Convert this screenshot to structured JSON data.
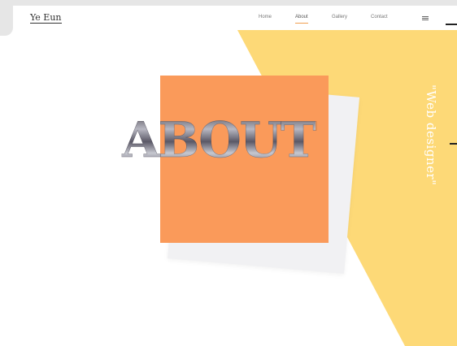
{
  "header": {
    "logo": "Ye Eun",
    "nav": [
      "Home",
      "About",
      "Gallery",
      "Contact"
    ],
    "menu_icon": "hamburger-menu-icon"
  },
  "hero": {
    "title": "ABOUT",
    "tagline": "\"Web designer\""
  },
  "colors": {
    "yellow": "#fdd977",
    "orange": "#fa9a5a",
    "grey": "#f1f1f3"
  }
}
